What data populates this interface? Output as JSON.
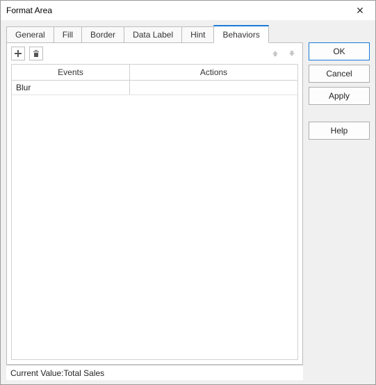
{
  "window": {
    "title": "Format Area",
    "close_glyph": "✕"
  },
  "tabs": [
    {
      "label": "General",
      "active": false
    },
    {
      "label": "Fill",
      "active": false
    },
    {
      "label": "Border",
      "active": false
    },
    {
      "label": "Data Label",
      "active": false
    },
    {
      "label": "Hint",
      "active": false
    },
    {
      "label": "Behaviors",
      "active": true
    }
  ],
  "table": {
    "headers": {
      "events": "Events",
      "actions": "Actions"
    },
    "rows": [
      {
        "event": "Blur",
        "action": ""
      }
    ]
  },
  "status": {
    "label": "Current Value:",
    "value": "Total Sales"
  },
  "buttons": {
    "ok": "OK",
    "cancel": "Cancel",
    "apply": "Apply",
    "help": "Help"
  }
}
